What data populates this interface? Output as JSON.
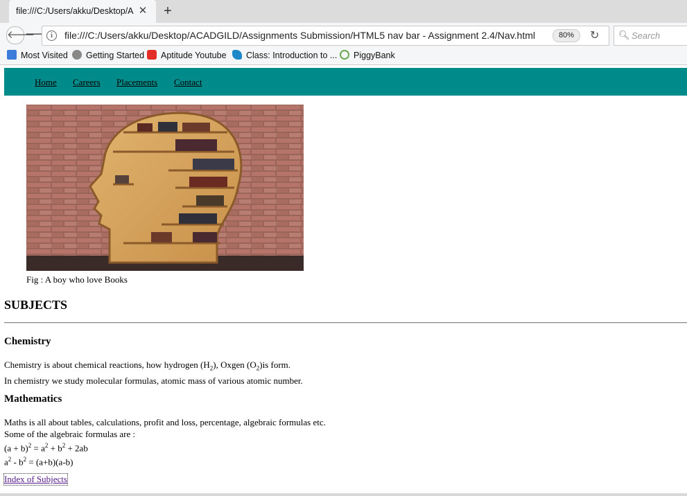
{
  "browser": {
    "tab_title": "file:///C:/Users/akku/Desktop/A",
    "url": "file:///C:/Users/akku/Desktop/ACADGILD/Assignments Submission/HTML5 nav bar - Assignment 2.4/Nav.html",
    "zoom": "80%",
    "search_placeholder": "Search",
    "bookmarks": [
      {
        "label": "Most Visited"
      },
      {
        "label": "Getting Started"
      },
      {
        "label": "Aptitude Youtube"
      },
      {
        "label": "Class: Introduction to ..."
      },
      {
        "label": "PiggyBank"
      }
    ]
  },
  "page": {
    "nav": [
      "Home",
      "Careers",
      "Placements",
      "Contact"
    ],
    "figure_caption": "Fig : A boy who love Books",
    "heading": "SUBJECTS",
    "chemistry": {
      "title": "Chemistry",
      "line1_a": "Chemistry is about chemical reactions, how hydrogen (H",
      "line1_sub1": "2",
      "line1_b": "), Oxgen (O",
      "line1_sub2": "2",
      "line1_c": ")is form.",
      "line2": "In chemistry we study molecular formulas, atomic mass of various atomic number."
    },
    "maths": {
      "title": "Mathematics",
      "line1": "Maths is all about tables, calculations, profit and loss, percentage, algebraic formulas etc.",
      "line2": "Some of the algebraic formulas are :",
      "f1_a": "(a + b)",
      "f1_sup1": "2",
      "f1_b": " = a",
      "f1_sup2": "2",
      "f1_c": " + b",
      "f1_sup3": "2",
      "f1_d": " + 2ab",
      "f2_a": "a",
      "f2_sup1": "2",
      "f2_b": " - b",
      "f2_sup2": "2",
      "f2_c": " = (a+b)(a-b)"
    },
    "index_link": "Index of Subjects"
  }
}
